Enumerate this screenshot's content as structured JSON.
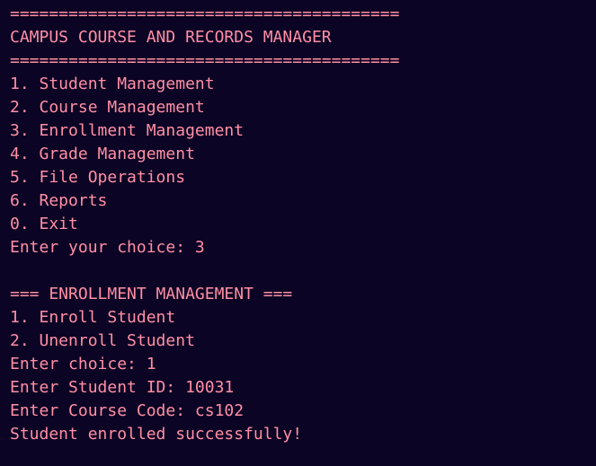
{
  "terminal": {
    "colors": {
      "background": "#0c0424",
      "text": "#ff8fa6"
    },
    "lines": [
      "========================================",
      "CAMPUS COURSE AND RECORDS MANAGER",
      "========================================",
      "1. Student Management",
      "2. Course Management",
      "3. Enrollment Management",
      "4. Grade Management",
      "5. File Operations",
      "6. Reports",
      "0. Exit",
      "Enter your choice: 3",
      "",
      "=== ENROLLMENT MANAGEMENT ===",
      "1. Enroll Student",
      "2. Unenroll Student",
      "Enter choice: 1",
      "Enter Student ID: 10031",
      "Enter Course Code: cs102",
      "Student enrolled successfully!"
    ]
  }
}
